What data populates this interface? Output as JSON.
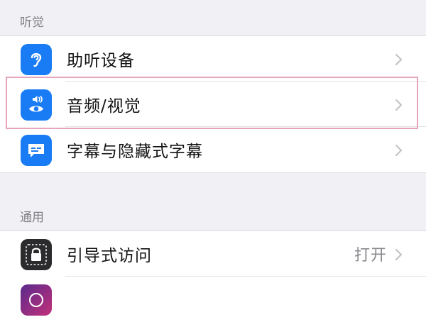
{
  "sections": {
    "hearing": {
      "header": "听觉",
      "items": [
        {
          "label": "助听设备",
          "icon": "hearing-aid-icon"
        },
        {
          "label": "音频/视觉",
          "icon": "audio-visual-icon"
        },
        {
          "label": "字幕与隐藏式字幕",
          "icon": "subtitles-icon"
        }
      ]
    },
    "general": {
      "header": "通用",
      "items": [
        {
          "label": "引导式访问",
          "value": "打开",
          "icon": "guided-access-lock-icon"
        }
      ]
    }
  },
  "colors": {
    "background": "#f0f0f5",
    "icon_blue": "#1a7cf5",
    "icon_dark": "#2b2b2e",
    "highlight_border": "#e6a5bd",
    "chevron": "#c4c4c8",
    "secondary_text": "#8a8a8e"
  }
}
